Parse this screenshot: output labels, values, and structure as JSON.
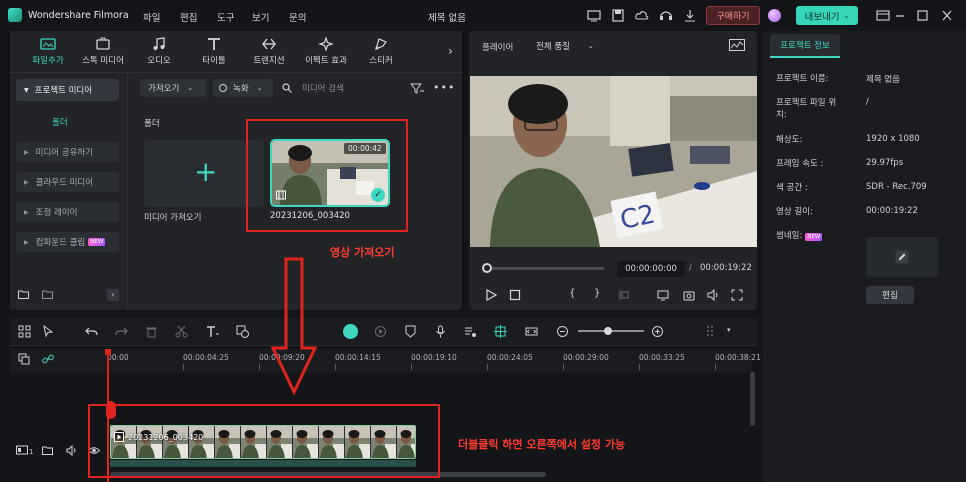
{
  "app": {
    "name": "Wondershare Filmora",
    "document_title": "제목 없음"
  },
  "menu": [
    "파일",
    "편집",
    "도구",
    "보기",
    "문의"
  ],
  "titlebar": {
    "buy_label": "구매하기",
    "export_label": "내보내기"
  },
  "media_tabs": [
    {
      "label": "파일추가",
      "icon": "folder-media-icon",
      "active": true
    },
    {
      "label": "스톡 미디어",
      "icon": "stock-media-icon",
      "active": false
    },
    {
      "label": "오디오",
      "icon": "music-note-icon",
      "active": false
    },
    {
      "label": "타이틀",
      "icon": "title-t-icon",
      "active": false
    },
    {
      "label": "트랜지션",
      "icon": "transition-icon",
      "active": false
    },
    {
      "label": "이펙트 효과",
      "icon": "effects-sparkle-icon",
      "active": false
    },
    {
      "label": "스티커",
      "icon": "sticker-icon",
      "active": false
    }
  ],
  "sidebar": {
    "project_media": "프로젝트 미디어",
    "folder": "폴더",
    "items": [
      {
        "label": "미디어 공유하기",
        "new": false
      },
      {
        "label": "클라우드 미디어",
        "new": false
      },
      {
        "label": "조정 레이어",
        "new": false
      },
      {
        "label": "컴파운드 클립",
        "new": true
      }
    ],
    "new_badge": "NEW"
  },
  "media_toolbar": {
    "import_label": "가져오기",
    "record_label": "녹화",
    "search_placeholder": "미디어 검색"
  },
  "media_area": {
    "folder_label": "폴더",
    "import_tile_label": "미디어 가져오기",
    "clip": {
      "name": "20231206_003420",
      "duration": "00:00:42",
      "selected": true
    }
  },
  "annotations": {
    "import_note": "영상 가져오기",
    "double_click_note": "더블클릭 하면 오른쪽에서 설정 가능"
  },
  "player": {
    "label": "플레이어",
    "quality": "전체 품질",
    "current_time": "00:00:00:00",
    "total_time": "00:00:19:22",
    "progress": 0
  },
  "project_info": {
    "tab_label": "프로젝트 정보",
    "rows": [
      {
        "key": "프로젝트 이름:",
        "value": "제목 없음"
      },
      {
        "key": "프로젝트 파일 위치:",
        "value": "/"
      },
      {
        "key": "해상도:",
        "value": "1920 x 1080"
      },
      {
        "key": "프레임 속도 :",
        "value": "29.97fps"
      },
      {
        "key": "색 공간 :",
        "value": "SDR - Rec.709"
      },
      {
        "key": "영상 길이:",
        "value": "00:00:19:22"
      }
    ],
    "thumbnail_label": "썸네일:",
    "edit_label": "편집"
  },
  "timeline": {
    "ruler": [
      "00:00",
      "00:00:04:25",
      "00:00:09:20",
      "00:00:14:15",
      "00:00:19:10",
      "00:00:24:05",
      "00:00:29:00",
      "00:00:33:25",
      "00:00:38:21"
    ],
    "track_clip_name": "20231206_003420",
    "track_number": "1",
    "zoom_level": 0.45
  },
  "colors": {
    "accent": "#3fd7bf",
    "annotation_red": "#e0241d",
    "panel": "#222428",
    "background": "#141518"
  }
}
